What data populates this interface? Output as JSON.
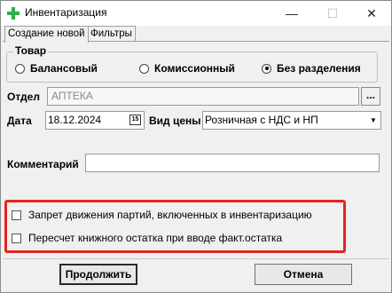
{
  "window": {
    "title": "Инвентаризация",
    "minimize": "—",
    "maximize": "☐",
    "close": "✕"
  },
  "tabs": [
    {
      "label": "Создание новой",
      "active": true
    },
    {
      "label": "Фильтры",
      "active": false
    }
  ],
  "goods": {
    "title": "Товар",
    "options": [
      {
        "label": "Балансовый",
        "checked": false
      },
      {
        "label": "Комиссионный",
        "checked": false
      },
      {
        "label": "Без разделения",
        "checked": true
      }
    ]
  },
  "form": {
    "department_label": "Отдел",
    "department_value": "АПТЕКА",
    "browse_label": "...",
    "date_label": "Дата",
    "date_value": "18.12.2024",
    "calendar_glyph": "15",
    "price_label": "Вид цены",
    "price_value": "Розничная с НДС и НП",
    "comment_label": "Комментарий",
    "comment_value": ""
  },
  "options": [
    {
      "label": "Запрет движения партий, включенных в инвентаризацию",
      "checked": false
    },
    {
      "label": "Пересчет книжного остатка при вводе факт.остатка",
      "checked": false
    }
  ],
  "buttons": {
    "continue": "Продолжить",
    "cancel": "Отмена"
  },
  "colors": {
    "highlight": "#e52521",
    "app_icon": "#2eae4a"
  }
}
